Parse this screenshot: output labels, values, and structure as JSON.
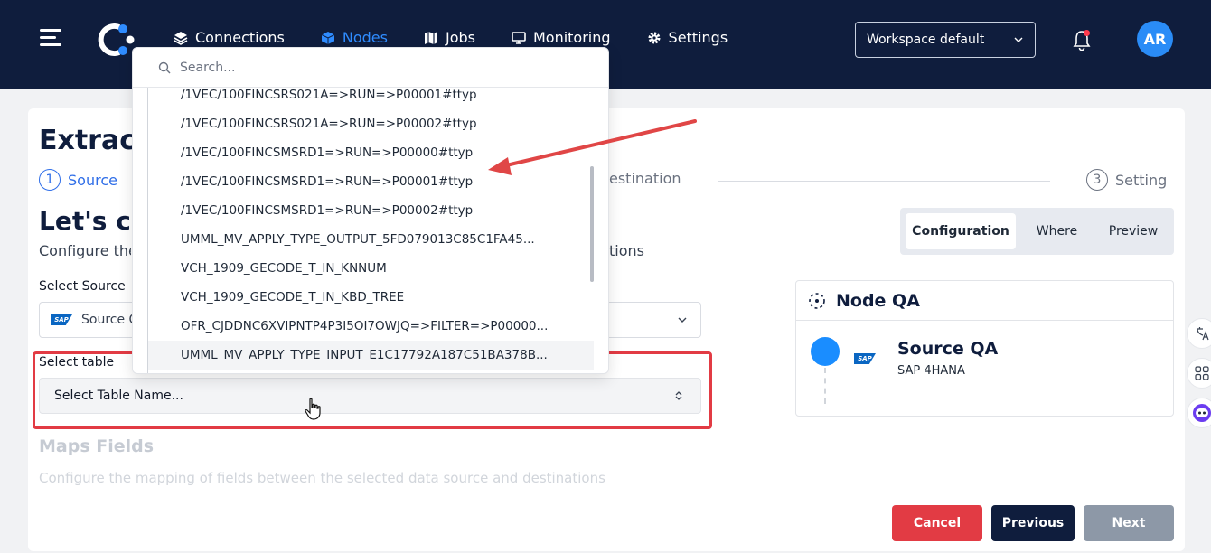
{
  "nav": {
    "items": [
      {
        "label": "Connections",
        "icon": "stack-icon"
      },
      {
        "label": "Nodes",
        "icon": "cube-icon"
      },
      {
        "label": "Jobs",
        "icon": "map-icon"
      },
      {
        "label": "Monitoring",
        "icon": "monitor-icon"
      },
      {
        "label": "Settings",
        "icon": "gear-icon"
      }
    ],
    "active": "Nodes",
    "workspace": "Workspace default",
    "avatar_initials": "AR"
  },
  "page": {
    "title": "Extract",
    "steps": [
      {
        "num": "1",
        "label": "Source"
      },
      {
        "num": "3",
        "label": "Setting"
      }
    ],
    "destination_fragment": "estination",
    "connect_title": "Let's co",
    "connect_sub": "Configure the",
    "connect_sub_tail": "tions",
    "select_source_label": "Select Source",
    "source_value": "Source Q",
    "select_table_label": "Select table",
    "select_table_value": "Select Table Name...",
    "maps_title": "Maps Fields",
    "maps_sub": "Configure the mapping of fields between the selected data source and destinations"
  },
  "tabs": [
    "Configuration",
    "Where",
    "Preview"
  ],
  "node": {
    "title": "Node QA",
    "source_name": "Source QA",
    "source_type": "SAP 4HANA",
    "sap_label": "SAP"
  },
  "buttons": {
    "cancel": "Cancel",
    "previous": "Previous",
    "next": "Next"
  },
  "dropdown": {
    "search_placeholder": "Search...",
    "items": [
      "/1VEC/100FINCSRS021A=>RUN=>P00001#ttyp",
      "/1VEC/100FINCSRS021A=>RUN=>P00002#ttyp",
      "/1VEC/100FINCSMSRD1=>RUN=>P00000#ttyp",
      "/1VEC/100FINCSMSRD1=>RUN=>P00001#ttyp",
      "/1VEC/100FINCSMSRD1=>RUN=>P00002#ttyp",
      "UMML_MV_APPLY_TYPE_OUTPUT_5FD079013C85C1FA45...",
      "VCH_1909_GECODE_T_IN_KNNUM",
      "VCH_1909_GECODE_T_IN_KBD_TREE",
      "OFR_CJDDNC6XVIPNTP4P3I5OI7OWJQ=>FILTER=>P00000...",
      "UMML_MV_APPLY_TYPE_INPUT_E1C17792A187C51BA378B..."
    ]
  },
  "side_tools": [
    "translate-icon",
    "apps-icon",
    "bot-icon"
  ],
  "colors": {
    "nav_bg": "#0f1d3d",
    "accent": "#2f8cff",
    "highlight": "#e23b44",
    "cancel": "#e23b44",
    "next_disabled": "#8d98a7"
  }
}
